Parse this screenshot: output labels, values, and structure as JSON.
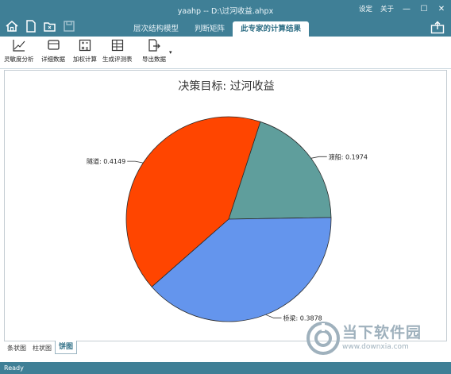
{
  "window": {
    "title": "yaahp -- D:\\过河收益.ahpx",
    "settings_label": "设定",
    "about_label": "关于",
    "minimize": "—",
    "maximize": "☐",
    "close": "✕"
  },
  "quick_access": [
    "home-icon",
    "new-file-icon",
    "open-folder-icon",
    "save-icon"
  ],
  "tabs": [
    {
      "label": "层次结构模型"
    },
    {
      "label": "判断矩阵"
    },
    {
      "label": "此专家的计算结果"
    }
  ],
  "toolbar": {
    "items": [
      {
        "label": "灵敏度分析",
        "icon": "sensitivity-icon"
      },
      {
        "label": "详细数据",
        "icon": "detail-data-icon"
      },
      {
        "label": "加权计算",
        "icon": "weighted-calc-icon"
      },
      {
        "label": "生成评测表",
        "icon": "evaluation-table-icon"
      },
      {
        "label": "导出数据",
        "icon": "export-icon"
      }
    ],
    "dropdown": "▾"
  },
  "chart_data": {
    "type": "pie",
    "title": "决策目标: 过河收益",
    "slices": [
      {
        "label": "渡船",
        "value": 0.1974,
        "color": "#5f9e9c"
      },
      {
        "label": "桥梁",
        "value": 0.3878,
        "color": "#6495ed"
      },
      {
        "label": "隧道",
        "value": 0.4149,
        "color": "#ff4500"
      }
    ],
    "slice_labels": [
      "渡船: 0.1974",
      "桥梁: 0.3878",
      "隧道: 0.4149"
    ]
  },
  "bottom_tabs": [
    {
      "label": "条状图"
    },
    {
      "label": "柱状图"
    },
    {
      "label": "饼图"
    }
  ],
  "status": "Ready",
  "watermark": {
    "text": "当下软件园",
    "url": "www.downxia.com"
  }
}
